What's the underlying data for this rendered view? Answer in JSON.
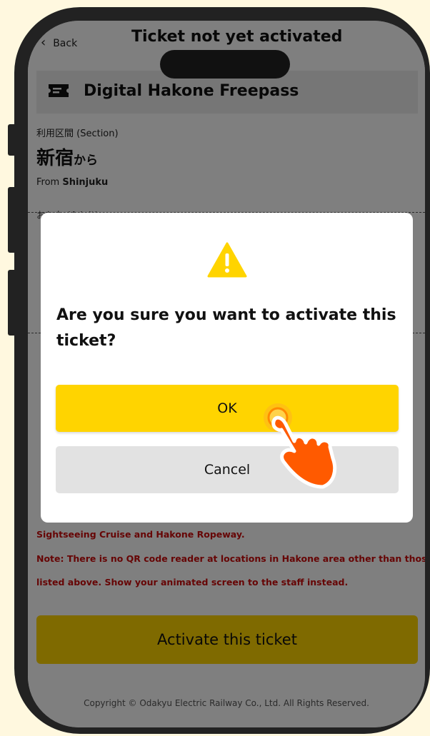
{
  "header": {
    "back_label": "Back",
    "title": "Ticket not yet activated"
  },
  "ticket": {
    "name": "Digital Hakone Freepass"
  },
  "section": {
    "label": "利用区間 (Section)",
    "from_jp": "新宿",
    "from_jp_suffix": "から",
    "from_en_prefix": "From ",
    "from_en_station": "Shinjuku",
    "adult_partial": "おとな (Adult)"
  },
  "notices": [
    "Sightseeing Cruise and Hakone Ropeway.",
    "Note: There is no QR code reader at locations in Hakone area other than those",
    "listed above. Show your animated screen to the staff instead."
  ],
  "activate_label": "Activate this ticket",
  "copyright": "Copyright © Odakyu Electric Railway Co., Ltd. All Rights Reserved.",
  "dialog": {
    "icon": "warning-icon",
    "message": "Are you sure you want to activate this ticket?",
    "ok_label": "OK",
    "cancel_label": "Cancel"
  },
  "colors": {
    "accent": "#ffd400",
    "notice": "#cc0a0a",
    "hand": "#ff5a00"
  }
}
